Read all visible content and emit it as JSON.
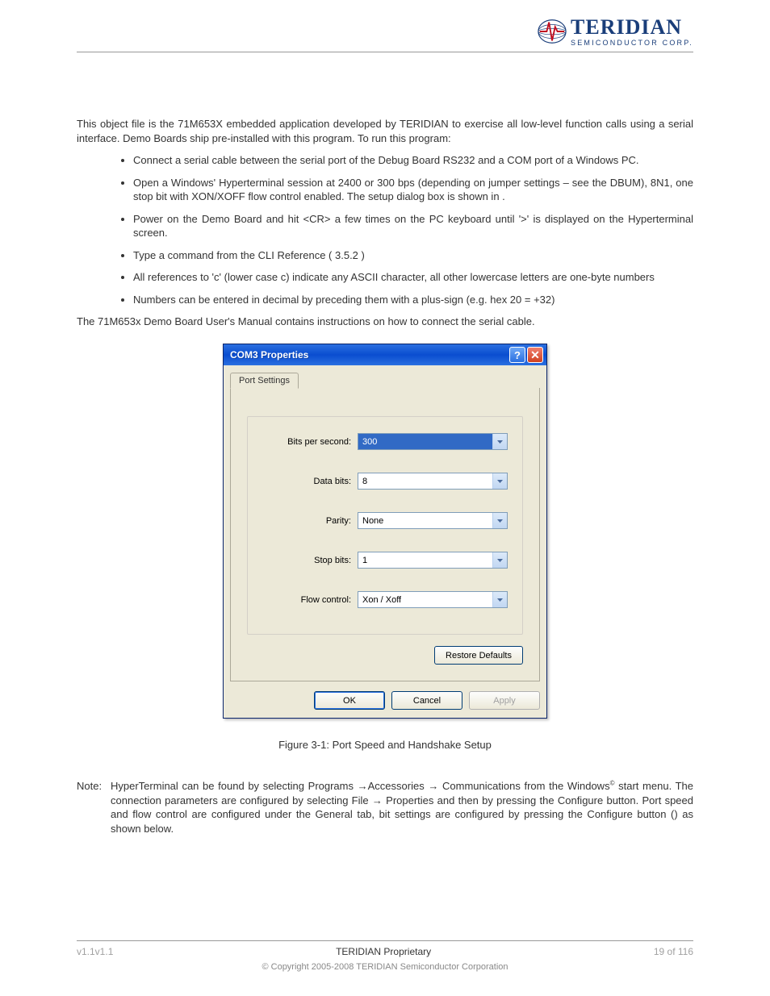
{
  "header": {
    "brand_main": "TERIDIAN",
    "brand_sub": "SEMICONDUCTOR CORP."
  },
  "body": {
    "intro": "This object file is the 71M653X embedded application developed by TERIDIAN to exercise all low-level function calls using a serial interface. Demo Boards ship pre-installed with this program. To run this program:",
    "bullets": [
      "Connect a serial cable between the serial port of the Debug Board RS232 and a COM port of a Windows PC.",
      "Open a Windows' Hyperterminal session at 2400 or 300 bps (depending on jumper settings – see the DBUM), 8N1, one stop bit with XON/XOFF flow control enabled. The setup dialog box is shown in .",
      "Power on the Demo Board and hit <CR> a few times on the PC keyboard until '>' is displayed on the Hyperterminal screen.",
      "Type a command from the CLI Reference ( 3.5.2 )",
      "All references to 'c' (lower case c) indicate any ASCII character, all other lowercase letters are one-byte numbers",
      "Numbers can be entered in decimal by preceding them with a plus-sign (e.g. hex 20 = +32)"
    ],
    "after_bullets": "The 71M653x Demo Board User's Manual contains instructions on how to connect the serial cable.",
    "figure_caption": "Figure 3-1: Port Speed and Handshake Setup",
    "note_label": "Note:",
    "note_text_1": "HyperTerminal can be found by selecting Programs ",
    "note_text_2": "Accessories ",
    "note_text_3": " Communications from the Windows",
    "note_text_4": " start menu. The connection parameters are configured by selecting File ",
    "note_text_5": " Properties and then by pressing the Configure button. Port speed and flow control are configured under the General tab, bit settings are configured by pressing the Configure button (",
    "note_text_6": ") as shown below."
  },
  "dialog": {
    "title": "COM3 Properties",
    "tab": "Port Settings",
    "fields": {
      "bps_label": "Bits per second:",
      "bps_value": "300",
      "databits_label": "Data bits:",
      "databits_value": "8",
      "parity_label": "Parity:",
      "parity_value": "None",
      "stopbits_label": "Stop bits:",
      "stopbits_value": "1",
      "flow_label": "Flow control:",
      "flow_value": "Xon / Xoff"
    },
    "restore_label": "Restore Defaults",
    "ok_label": "OK",
    "cancel_label": "Cancel",
    "apply_label": "Apply"
  },
  "footer": {
    "version": "v1.1v1.1",
    "center": "TERIDIAN Proprietary",
    "page": "19 of 116",
    "copyright": "© Copyright 2005-2008 TERIDIAN Semiconductor Corporation"
  }
}
